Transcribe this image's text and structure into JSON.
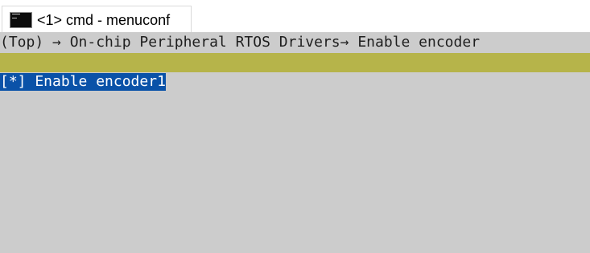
{
  "tab": {
    "title": "<1> cmd - menuconf",
    "icon": "terminal-icon"
  },
  "terminal": {
    "breadcrumb": "(Top) → On-chip Peripheral RTOS Drivers→ Enable encoder",
    "selected_item": "[*] Enable encoder1",
    "colors": {
      "background": "#cccccc",
      "menu_bar": "#b6b44a",
      "selection": "#0a52a8",
      "selection_text": "#ffffff"
    }
  }
}
